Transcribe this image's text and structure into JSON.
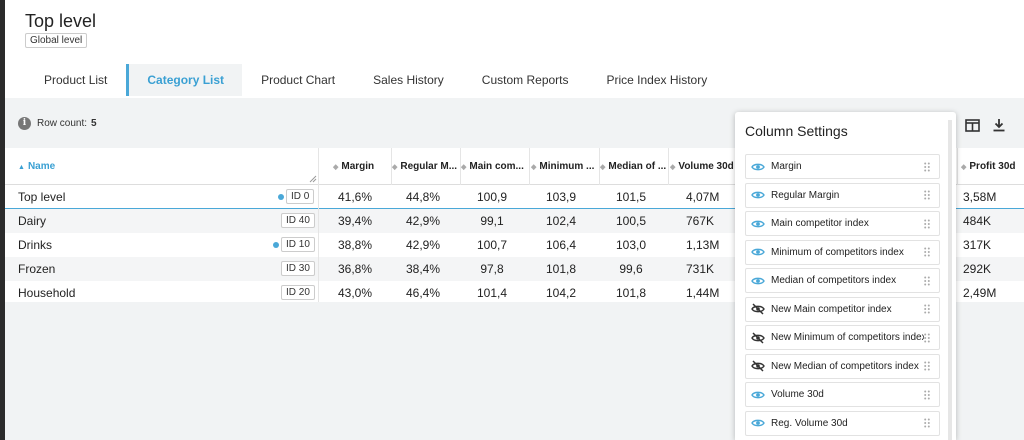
{
  "header": {
    "title": "Top level",
    "level_badge": "Global level"
  },
  "tabs": [
    {
      "label": "Product List",
      "active": false
    },
    {
      "label": "Category List",
      "active": true
    },
    {
      "label": "Product Chart",
      "active": false
    },
    {
      "label": "Sales History",
      "active": false
    },
    {
      "label": "Custom Reports",
      "active": false
    },
    {
      "label": "Price Index History",
      "active": false
    }
  ],
  "toolbar": {
    "row_count_label": "Row count:",
    "row_count_value": "5",
    "icons": [
      "info-icon",
      "columns-icon",
      "download-icon"
    ]
  },
  "table": {
    "columns": [
      "Name",
      "Margin",
      "Regular M...",
      "Main com...",
      "Minimum ...",
      "Median of ...",
      "Volume 30d",
      "Profit 30d"
    ],
    "rows": [
      {
        "name": "Top level",
        "id": "ID 0",
        "dot": true,
        "margin": "41,6%",
        "regular_margin": "44,8%",
        "main_comp": "100,9",
        "minimum": "103,9",
        "median": "101,5",
        "volume": "4,07M",
        "profit": "3,58M"
      },
      {
        "name": "Dairy",
        "id": "ID 40",
        "dot": false,
        "margin": "39,4%",
        "regular_margin": "42,9%",
        "main_comp": "99,1",
        "minimum": "102,4",
        "median": "100,5",
        "volume": "767K",
        "profit": "484K"
      },
      {
        "name": "Drinks",
        "id": "ID 10",
        "dot": true,
        "margin": "38,8%",
        "regular_margin": "42,9%",
        "main_comp": "100,7",
        "minimum": "106,4",
        "median": "103,0",
        "volume": "1,13M",
        "profit": "317K"
      },
      {
        "name": "Frozen",
        "id": "ID 30",
        "dot": false,
        "margin": "36,8%",
        "regular_margin": "38,4%",
        "main_comp": "97,8",
        "minimum": "101,8",
        "median": "99,6",
        "volume": "731K",
        "profit": "292K"
      },
      {
        "name": "Household",
        "id": "ID 20",
        "dot": false,
        "margin": "43,0%",
        "regular_margin": "46,4%",
        "main_comp": "101,4",
        "minimum": "104,2",
        "median": "101,8",
        "volume": "1,44M",
        "profit": "2,49M"
      }
    ]
  },
  "column_settings": {
    "title": "Column Settings",
    "items": [
      {
        "label": "Margin",
        "visible": true
      },
      {
        "label": "Regular Margin",
        "visible": true
      },
      {
        "label": "Main competitor index",
        "visible": true
      },
      {
        "label": "Minimum of competitors index",
        "visible": true
      },
      {
        "label": "Median of competitors index",
        "visible": true
      },
      {
        "label": "New Main competitor index",
        "visible": false
      },
      {
        "label": "New Minimum of competitors index",
        "visible": false
      },
      {
        "label": "New Median of competitors index",
        "visible": false
      },
      {
        "label": "Volume 30d",
        "visible": true
      },
      {
        "label": "Reg. Volume 30d",
        "visible": true
      }
    ]
  },
  "colors": {
    "accent": "#4aa8d8",
    "active_tab_text": "#3aa0d3",
    "eye_visible": "#4aa8d8",
    "eye_hidden": "#333333"
  }
}
